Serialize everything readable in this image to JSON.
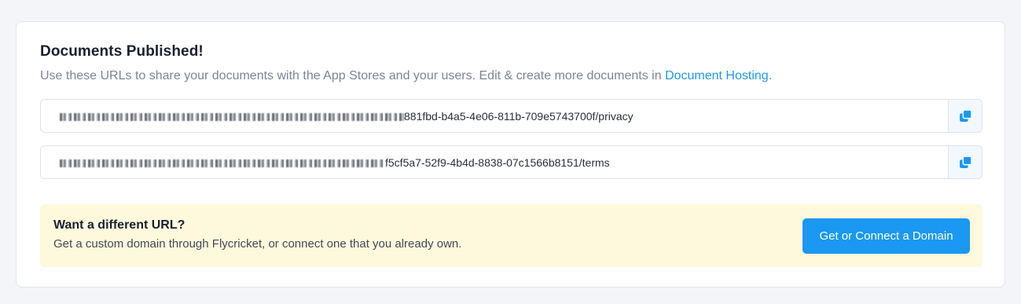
{
  "card": {
    "title": "Documents Published!",
    "subtitle_text": "Use these URLs to share your documents with the App Stores and your users. Edit & create more documents in ",
    "subtitle_link": "Document Hosting",
    "subtitle_end": "."
  },
  "urls": [
    {
      "visible_suffix": "881fbd-b4a5-4e06-811b-709e5743700f/privacy",
      "copy_icon": "copy-icon"
    },
    {
      "visible_suffix": "f5cf5a7-52f9-4b4d-8838-07c1566b8151/terms",
      "copy_icon": "copy-icon"
    }
  ],
  "promo": {
    "title": "Want a different URL?",
    "description": "Get a custom domain through Flycricket, or connect one that you already own.",
    "button_label": "Get or Connect a Domain"
  },
  "colors": {
    "accent": "#1a98f2",
    "link": "#1d9bf0",
    "promo_bg": "#fef9dd",
    "page_bg": "#f3f5f8"
  }
}
